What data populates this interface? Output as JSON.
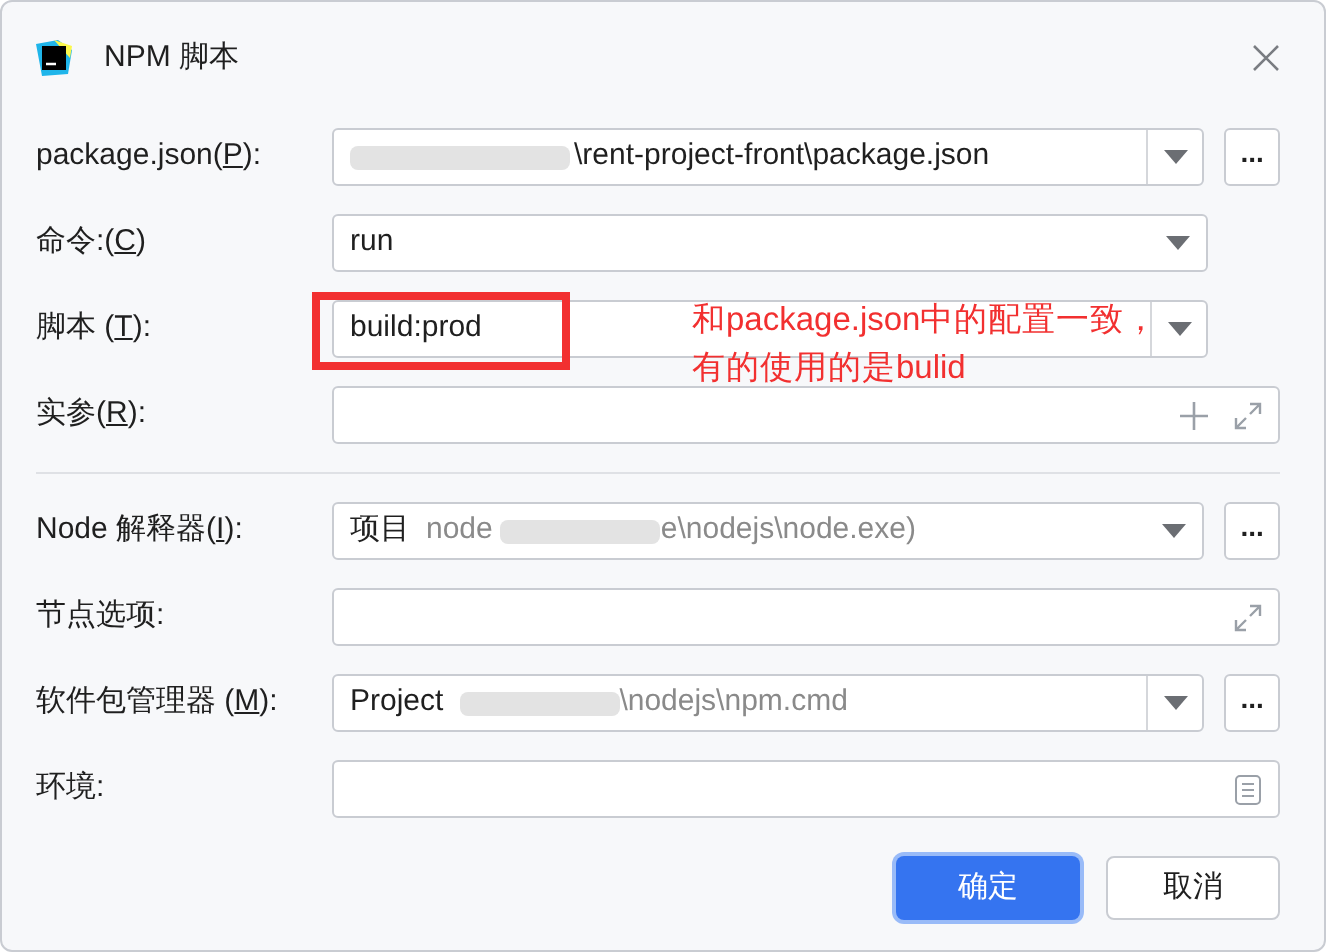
{
  "window": {
    "title": "NPM 脚本"
  },
  "rows": [
    {
      "kind": "combo",
      "label": {
        "before": "package.json(",
        "key": "P",
        "after": "):"
      },
      "value": "\\rent-project-front\\package.json",
      "blurred": true,
      "editable": true,
      "browse": true
    },
    {
      "kind": "combo",
      "label": {
        "before": "命令:(",
        "key": "C",
        "after": ")"
      },
      "value": "run",
      "editable": false,
      "browse": false
    },
    {
      "kind": "combo",
      "label": {
        "before": "脚本 (",
        "key": "T",
        "after": "):"
      },
      "value": "build:prod",
      "editable": true,
      "browse": false
    },
    {
      "kind": "text",
      "label": {
        "before": "实参(",
        "key": "R",
        "after": "):"
      },
      "icons": [
        {
          "kind": "plus"
        },
        {
          "kind": "expand"
        }
      ]
    },
    {
      "kind": "divider"
    },
    {
      "kind": "combo",
      "label": {
        "before": "Node 解释器(",
        "key": "I",
        "after": "):"
      },
      "prefix": "项目",
      "muted": "node",
      "muted_tail": "e\\nodejs\\node.exe)",
      "blurred": true,
      "editable": false,
      "browse": true
    },
    {
      "kind": "text",
      "label": {
        "before": "节点选项:"
      },
      "icons": [
        {
          "kind": "expand"
        }
      ]
    },
    {
      "kind": "combo",
      "label": {
        "before": "软件包管理器 (",
        "key": "M",
        "after": "):"
      },
      "prefix": "Project",
      "muted_tail": "\\nodejs\\npm.cmd",
      "blurred": true,
      "editable": true,
      "browse": true
    },
    {
      "kind": "text",
      "label": {
        "before": "环境:"
      },
      "icons": [
        {
          "kind": "list"
        }
      ]
    }
  ],
  "browse_label": "...",
  "annotation": {
    "lines": [
      "和package.json中的配置一致，",
      "有的使用的是bulid"
    ]
  },
  "buttons": [
    {
      "label": "确定",
      "primary": true
    },
    {
      "label": "取消",
      "primary": false
    }
  ]
}
